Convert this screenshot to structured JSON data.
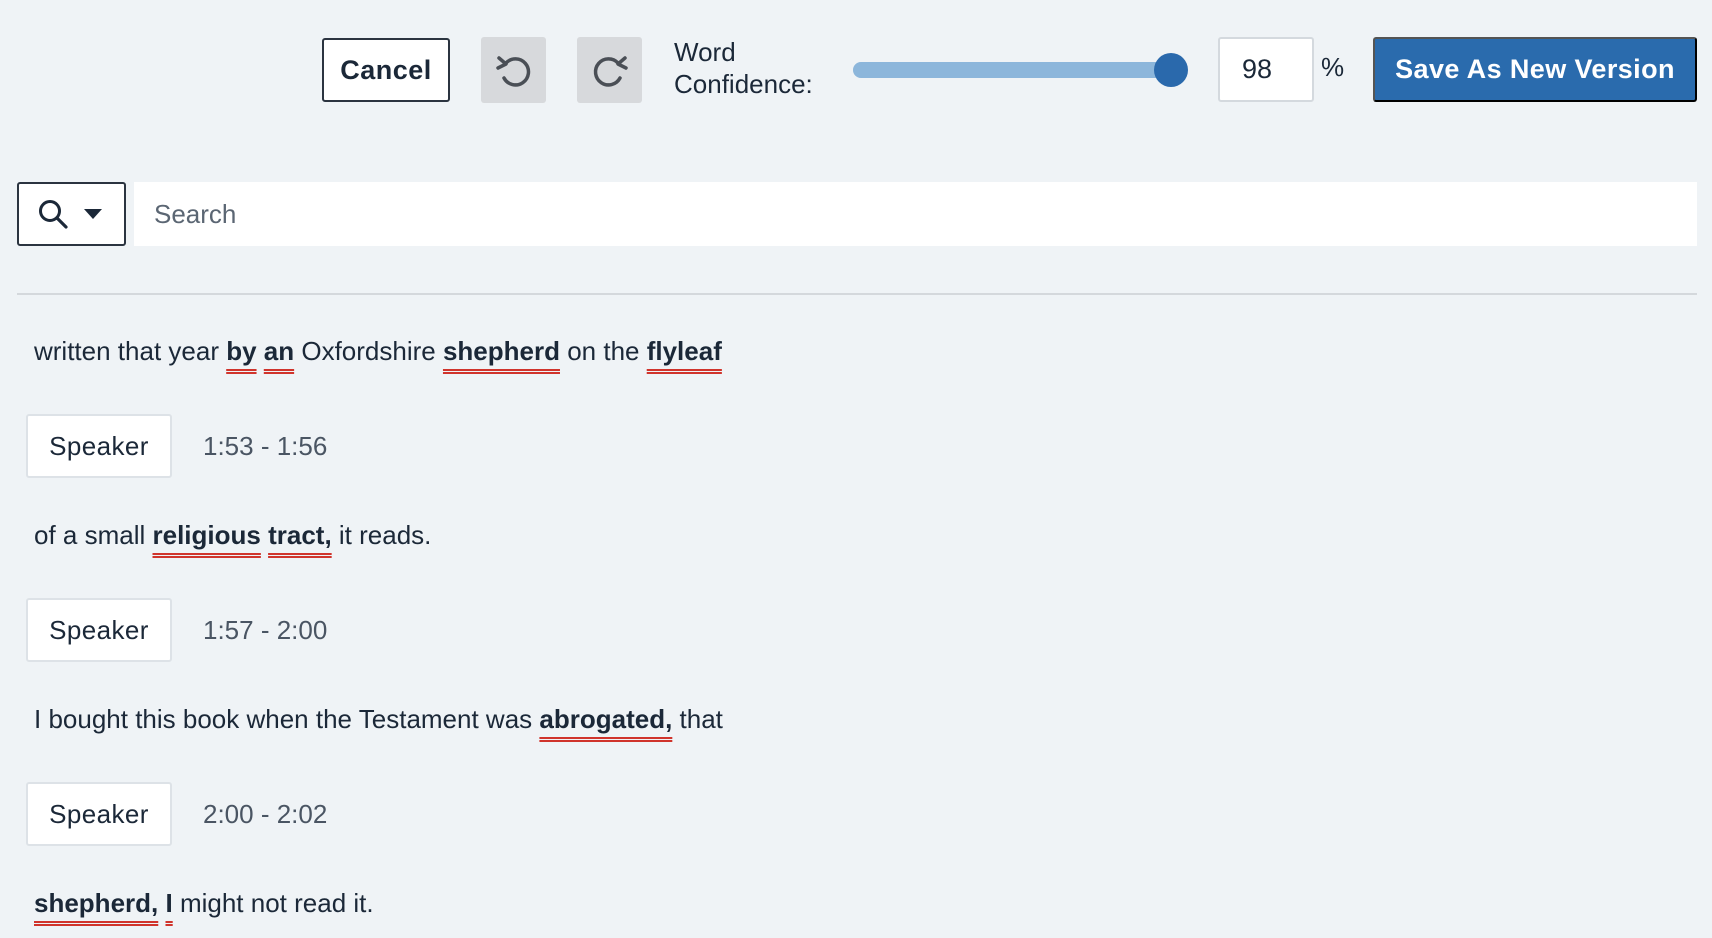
{
  "toolbar": {
    "cancel_label": "Cancel",
    "undo_icon": "undo-icon",
    "redo_icon": "redo-icon",
    "confidence_label": "Word Confidence:",
    "confidence_value": "98",
    "confidence_percent": 98,
    "percent_sign": "%",
    "save_label": "Save As New Version"
  },
  "search": {
    "icon": "search-icon",
    "dropdown_icon": "caret-down-icon",
    "placeholder": "Search"
  },
  "colors": {
    "accent": "#2a6bad",
    "low_confidence_underline": "#d0342c",
    "background": "#eff3f6"
  },
  "transcript": {
    "segments": [
      {
        "words": [
          {
            "t": "written that year ",
            "low": false
          },
          {
            "t": "by",
            "low": true
          },
          {
            "t": " ",
            "low": false
          },
          {
            "t": "an",
            "low": true
          },
          {
            "t": " Oxfordshire ",
            "low": false
          },
          {
            "t": "shepherd",
            "low": true
          },
          {
            "t": " on the ",
            "low": false
          },
          {
            "t": "flyleaf",
            "low": true
          }
        ]
      },
      {
        "speaker": "Speaker",
        "time": "1:53 - 1:56",
        "words": [
          {
            "t": "of a small ",
            "low": false
          },
          {
            "t": "religious",
            "low": true
          },
          {
            "t": " ",
            "low": false
          },
          {
            "t": "tract,",
            "low": true
          },
          {
            "t": " it reads.",
            "low": false
          }
        ]
      },
      {
        "speaker": "Speaker",
        "time": "1:57 - 2:00",
        "words": [
          {
            "t": "I bought this book when the Testament was ",
            "low": false
          },
          {
            "t": "abrogated,",
            "low": true
          },
          {
            "t": " that",
            "low": false
          }
        ]
      },
      {
        "speaker": "Speaker",
        "time": "2:00 - 2:02",
        "words": [
          {
            "t": "shepherd,",
            "low": true
          },
          {
            "t": " ",
            "low": false
          },
          {
            "t": "I",
            "low": true
          },
          {
            "t": " might not read it.",
            "low": false
          }
        ]
      }
    ]
  }
}
